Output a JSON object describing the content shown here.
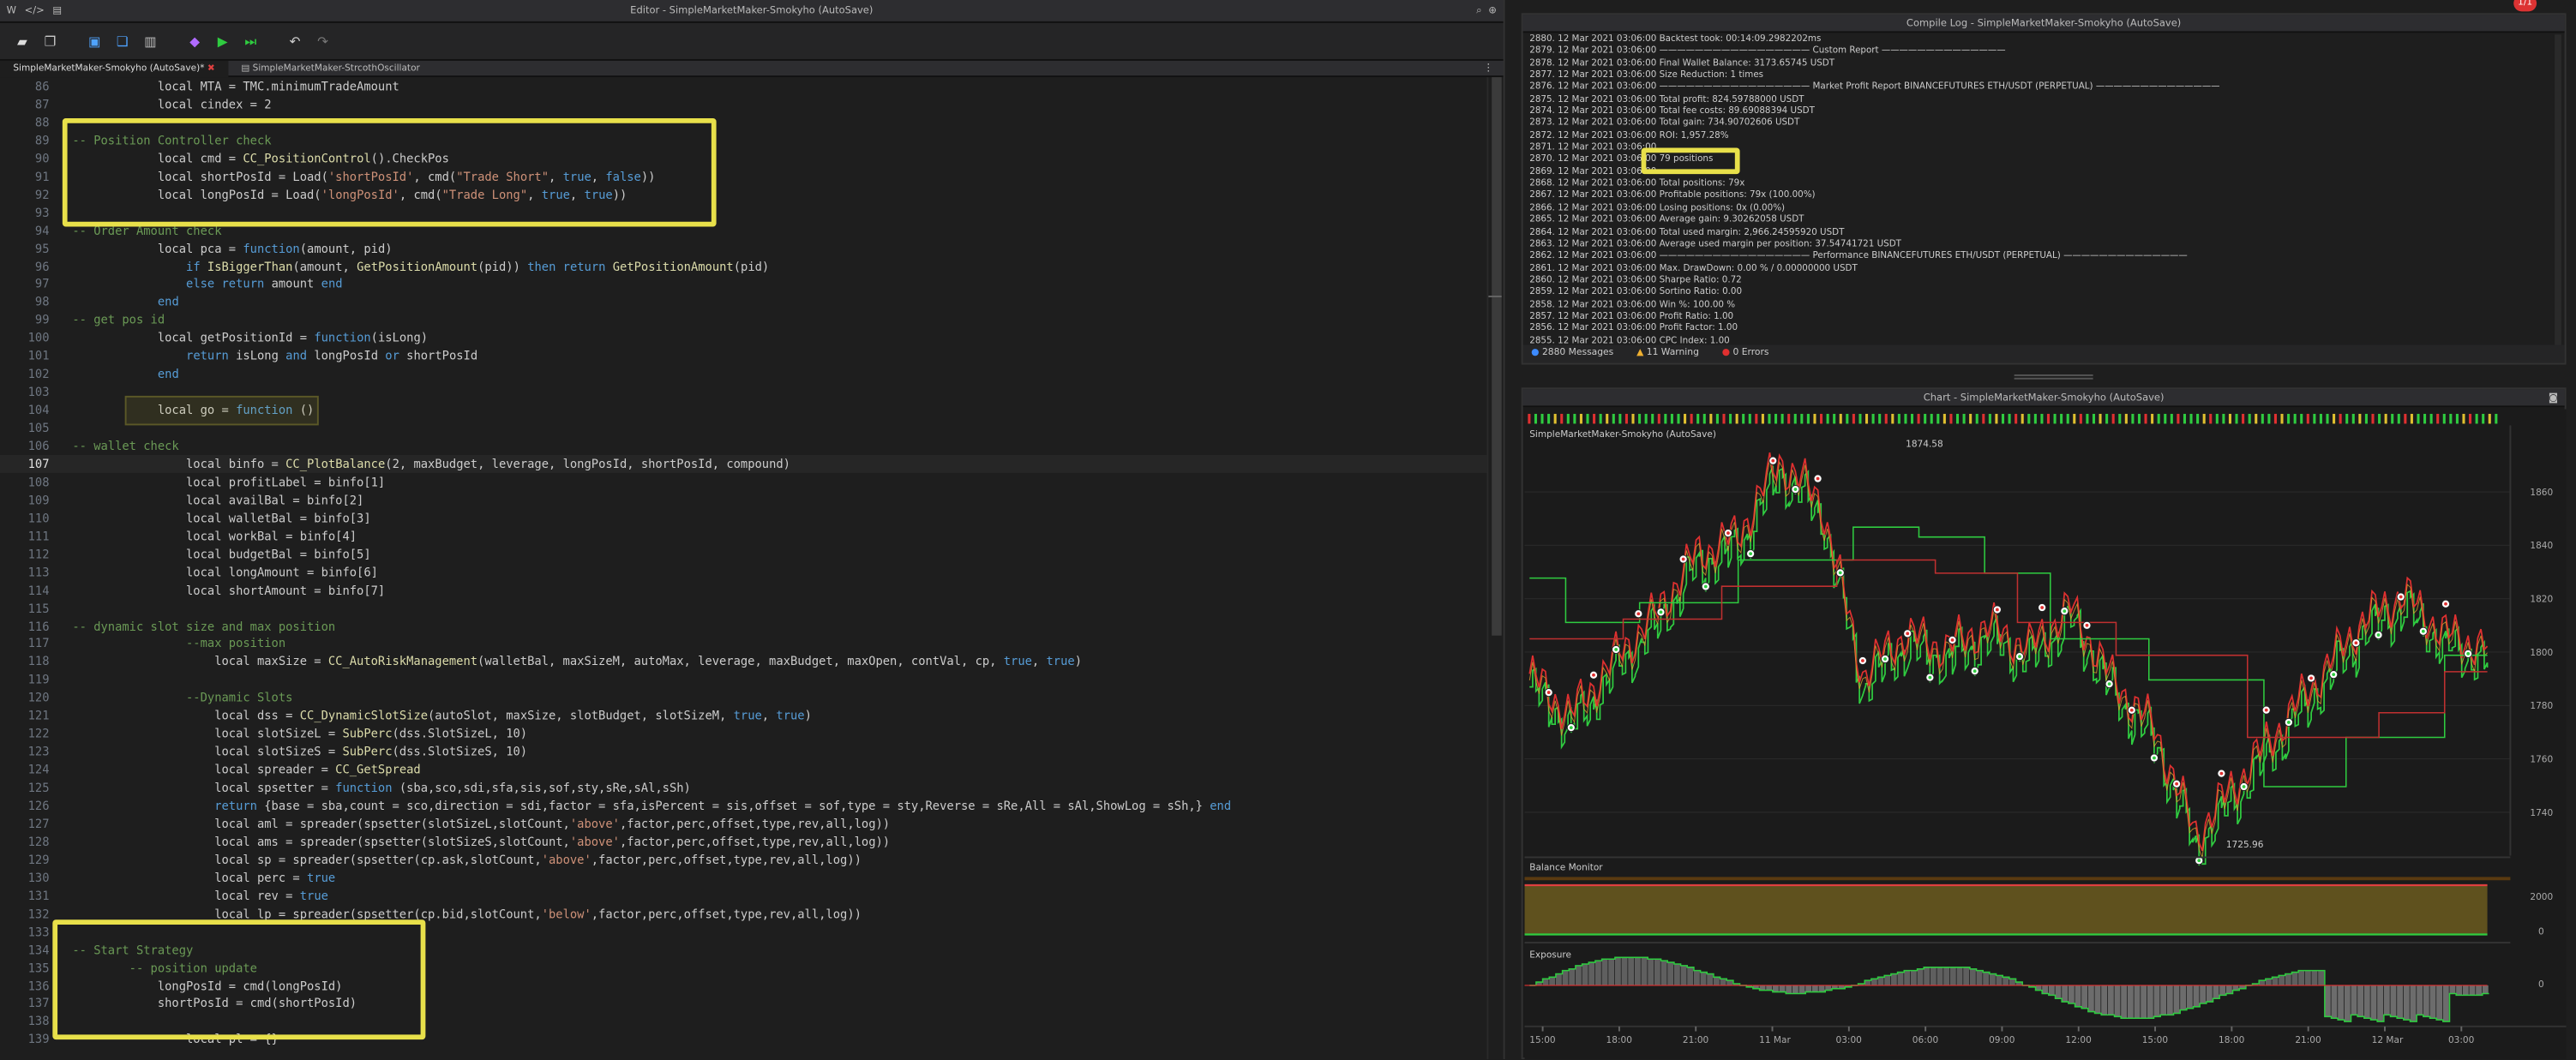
{
  "editor": {
    "title": "Editor - SimpleMarketMaker-Smokyho (AutoSave)",
    "tabs": [
      "SimpleMarketMaker-Smokyho (AutoSave)*",
      "SimpleMarketMaker-StrcothOscillator"
    ],
    "lines": [
      {
        "n": "86",
        "t": [
          [
            "            local MTA = TMC.minimumTradeAmount",
            ""
          ]
        ]
      },
      {
        "n": "87",
        "t": [
          [
            "            local cindex = 2",
            ""
          ]
        ]
      },
      {
        "n": "88",
        "t": [
          [
            "",
            ""
          ]
        ]
      },
      {
        "n": "89",
        "t": [
          [
            "-- Position Controller check",
            "c"
          ]
        ]
      },
      {
        "n": "90",
        "t": [
          [
            "            local cmd = ",
            ""
          ],
          [
            "CC_PositionControl",
            "f"
          ],
          [
            "().CheckPos",
            ""
          ]
        ]
      },
      {
        "n": "91",
        "t": [
          [
            "            local shortPosId = Load(",
            ""
          ],
          [
            "'shortPosId'",
            "s"
          ],
          [
            ", cmd(",
            ""
          ],
          [
            "\"Trade Short\"",
            "s"
          ],
          [
            ", ",
            ""
          ],
          [
            "true",
            "b"
          ],
          [
            ", ",
            ""
          ],
          [
            "false",
            "b"
          ],
          [
            "))",
            ""
          ]
        ]
      },
      {
        "n": "92",
        "t": [
          [
            "            local longPosId = Load(",
            ""
          ],
          [
            "'longPosId'",
            "s"
          ],
          [
            ", cmd(",
            ""
          ],
          [
            "\"Trade Long\"",
            "s"
          ],
          [
            ", ",
            ""
          ],
          [
            "true",
            "b"
          ],
          [
            ", ",
            ""
          ],
          [
            "true",
            "b"
          ],
          [
            "))",
            ""
          ]
        ]
      },
      {
        "n": "93",
        "t": [
          [
            "",
            ""
          ]
        ]
      },
      {
        "n": "94",
        "t": [
          [
            "-- Order Amount check",
            "c"
          ]
        ]
      },
      {
        "n": "95",
        "t": [
          [
            "            local pca = ",
            ""
          ],
          [
            "function",
            "k"
          ],
          [
            "(amount, pid)",
            ""
          ]
        ]
      },
      {
        "n": "96",
        "t": [
          [
            "                ",
            ""
          ],
          [
            "if",
            "k"
          ],
          [
            " ",
            ""
          ],
          [
            "IsBiggerThan",
            "f"
          ],
          [
            "(amount, ",
            ""
          ],
          [
            "GetPositionAmount",
            "f"
          ],
          [
            "(pid)) ",
            ""
          ],
          [
            "then",
            "k"
          ],
          [
            " ",
            ""
          ],
          [
            "return",
            "k"
          ],
          [
            " ",
            ""
          ],
          [
            "GetPositionAmount",
            "f"
          ],
          [
            "(pid)",
            ""
          ]
        ]
      },
      {
        "n": "97",
        "t": [
          [
            "                ",
            ""
          ],
          [
            "else",
            "k"
          ],
          [
            " ",
            ""
          ],
          [
            "return",
            "k"
          ],
          [
            " amount ",
            ""
          ],
          [
            "end",
            "k"
          ]
        ]
      },
      {
        "n": "98",
        "t": [
          [
            "            ",
            ""
          ],
          [
            "end",
            "k"
          ]
        ]
      },
      {
        "n": "99",
        "t": [
          [
            "-- get pos id",
            "c"
          ]
        ]
      },
      {
        "n": "100",
        "t": [
          [
            "            local getPositionId = ",
            ""
          ],
          [
            "function",
            "k"
          ],
          [
            "(isLong)",
            ""
          ]
        ]
      },
      {
        "n": "101",
        "t": [
          [
            "                ",
            ""
          ],
          [
            "return",
            "k"
          ],
          [
            " isLong ",
            ""
          ],
          [
            "and",
            "k"
          ],
          [
            " longPosId ",
            ""
          ],
          [
            "or",
            "k"
          ],
          [
            " shortPosId",
            ""
          ]
        ]
      },
      {
        "n": "102",
        "t": [
          [
            "            ",
            ""
          ],
          [
            "end",
            "k"
          ]
        ]
      },
      {
        "n": "103",
        "t": [
          [
            "",
            ""
          ]
        ]
      },
      {
        "n": "104",
        "t": [
          [
            "            local go = ",
            ""
          ],
          [
            "function",
            "k"
          ],
          [
            " ()",
            ""
          ]
        ]
      },
      {
        "n": "105",
        "t": [
          [
            "",
            ""
          ]
        ]
      },
      {
        "n": "106",
        "t": [
          [
            "-- wallet check",
            "c"
          ]
        ]
      },
      {
        "n": "107",
        "t": [
          [
            "                local binfo = ",
            ""
          ],
          [
            "CC_PlotBalance",
            "f"
          ],
          [
            "(2, maxBudget, leverage, longPosId, shortPosId, compound)",
            ""
          ]
        ]
      },
      {
        "n": "108",
        "t": [
          [
            "                local profitLabel = binfo[1]",
            ""
          ]
        ]
      },
      {
        "n": "109",
        "t": [
          [
            "                local availBal = binfo[2]",
            ""
          ]
        ]
      },
      {
        "n": "110",
        "t": [
          [
            "                local walletBal = binfo[3]",
            ""
          ]
        ]
      },
      {
        "n": "111",
        "t": [
          [
            "                local workBal = binfo[4]",
            ""
          ]
        ]
      },
      {
        "n": "112",
        "t": [
          [
            "                local budgetBal = binfo[5]",
            ""
          ]
        ]
      },
      {
        "n": "113",
        "t": [
          [
            "                local longAmount = binfo[6]",
            ""
          ]
        ]
      },
      {
        "n": "114",
        "t": [
          [
            "                local shortAmount = binfo[7]",
            ""
          ]
        ]
      },
      {
        "n": "115",
        "t": [
          [
            "",
            ""
          ]
        ]
      },
      {
        "n": "116",
        "t": [
          [
            "-- dynamic slot size and max position",
            "c"
          ]
        ]
      },
      {
        "n": "117",
        "t": [
          [
            "                --max position",
            "c"
          ]
        ]
      },
      {
        "n": "118",
        "t": [
          [
            "                    local maxSize = ",
            ""
          ],
          [
            "CC_AutoRiskManagement",
            "f"
          ],
          [
            "(walletBal, maxSizeM, autoMax, leverage, maxBudget, maxOpen, contVal, cp, ",
            ""
          ],
          [
            "true",
            "b"
          ],
          [
            ", ",
            ""
          ],
          [
            "true",
            "b"
          ],
          [
            ")",
            ""
          ]
        ]
      },
      {
        "n": "119",
        "t": [
          [
            "",
            ""
          ]
        ]
      },
      {
        "n": "120",
        "t": [
          [
            "                --Dynamic Slots",
            "c"
          ]
        ]
      },
      {
        "n": "121",
        "t": [
          [
            "                    local dss = ",
            ""
          ],
          [
            "CC_DynamicSlotSize",
            "f"
          ],
          [
            "(autoSlot, maxSize, slotBudget, slotSizeM, ",
            ""
          ],
          [
            "true",
            "b"
          ],
          [
            ", ",
            ""
          ],
          [
            "true",
            "b"
          ],
          [
            ")",
            ""
          ]
        ]
      },
      {
        "n": "122",
        "t": [
          [
            "                    local slotSizeL = ",
            ""
          ],
          [
            "SubPerc",
            "f"
          ],
          [
            "(dss.SlotSizeL, 10)",
            ""
          ]
        ]
      },
      {
        "n": "123",
        "t": [
          [
            "                    local slotSizeS = ",
            ""
          ],
          [
            "SubPerc",
            "f"
          ],
          [
            "(dss.SlotSizeS, 10)",
            ""
          ]
        ]
      },
      {
        "n": "124",
        "t": [
          [
            "                    local spreader = ",
            ""
          ],
          [
            "CC_GetSpread",
            "f"
          ]
        ]
      },
      {
        "n": "125",
        "t": [
          [
            "                    local spsetter = ",
            ""
          ],
          [
            "function",
            "k"
          ],
          [
            " (sba,sco,sdi,sfa,sis,sof,sty,sRe,sAl,sSh)",
            ""
          ]
        ]
      },
      {
        "n": "126",
        "t": [
          [
            "                    ",
            ""
          ],
          [
            "return",
            "k"
          ],
          [
            " {base = sba,count = sco,direction = sdi,factor = sfa,isPercent = sis,offset = sof,type = sty,Reverse = sRe,All = sAl,ShowLog = sSh,} ",
            ""
          ],
          [
            "end",
            "k"
          ]
        ]
      },
      {
        "n": "127",
        "t": [
          [
            "                    local aml = spreader(spsetter(slotSizeL,slotCount,",
            ""
          ],
          [
            "'above'",
            "s"
          ],
          [
            ",factor,perc,offset,type,rev,all,log))",
            ""
          ]
        ]
      },
      {
        "n": "128",
        "t": [
          [
            "                    local ams = spreader(spsetter(slotSizeS,slotCount,",
            ""
          ],
          [
            "'above'",
            "s"
          ],
          [
            ",factor,perc,offset,type,rev,all,log))",
            ""
          ]
        ]
      },
      {
        "n": "129",
        "t": [
          [
            "                    local sp = spreader(spsetter(cp.ask,slotCount,",
            ""
          ],
          [
            "'above'",
            "s"
          ],
          [
            ",factor,perc,offset,type,rev,all,log))",
            ""
          ]
        ]
      },
      {
        "n": "130",
        "t": [
          [
            "                    local perc = ",
            ""
          ],
          [
            "true",
            "b"
          ]
        ]
      },
      {
        "n": "131",
        "t": [
          [
            "                    local rev = ",
            ""
          ],
          [
            "true",
            "b"
          ]
        ]
      },
      {
        "n": "132",
        "t": [
          [
            "                    local lp = spreader(spsetter(cp.bid,slotCount,",
            ""
          ],
          [
            "'below'",
            "s"
          ],
          [
            ",factor,perc,offset,type,rev,all,log))",
            ""
          ]
        ]
      },
      {
        "n": "133",
        "t": [
          [
            "",
            ""
          ]
        ]
      },
      {
        "n": "134",
        "t": [
          [
            "-- Start Strategy",
            "c"
          ]
        ]
      },
      {
        "n": "135",
        "t": [
          [
            "        -- position update",
            "c"
          ]
        ]
      },
      {
        "n": "136",
        "t": [
          [
            "            longPosId = cmd(longPosId)",
            ""
          ]
        ]
      },
      {
        "n": "137",
        "t": [
          [
            "            shortPosId = cmd(shortPosId)",
            ""
          ]
        ]
      },
      {
        "n": "138",
        "t": [
          [
            "",
            ""
          ]
        ]
      },
      {
        "n": "139",
        "t": [
          [
            "                local pl = {}",
            ""
          ]
        ]
      }
    ]
  },
  "log": {
    "title": "Compile Log - SimpleMarketMaker-Smokyho (AutoSave)",
    "lines": [
      "2880. 12 Mar 2021 03:06:00 Backtest took: 00:14:09.2982202ms",
      "2879. 12 Mar 2021 03:06:00 ————————————————— Custom Report ——————————————",
      "2878. 12 Mar 2021 03:06:00 Final Wallet Balance: 3173.65745 USDT",
      "2877. 12 Mar 2021 03:06:00 Size Reduction: 1 times",
      "2876. 12 Mar 2021 03:06:00 ————————————————— Market Profit Report BINANCEFUTURES ETH/USDT (PERPETUAL) ——————————————",
      "2875. 12 Mar 2021 03:06:00 Total profit: 824.59788000 USDT",
      "2874. 12 Mar 2021 03:06:00 Total fee costs: 89.69088394 USDT",
      "2873. 12 Mar 2021 03:06:00 Total gain: 734.90702606 USDT",
      "2872. 12 Mar 2021 03:06:00 ROI: 1,957.28%",
      "2871. 12 Mar 2021 03:06:00",
      "2870. 12 Mar 2021 03:06:00 79 positions",
      "2869. 12 Mar 2021 03:06:00",
      "2868. 12 Mar 2021 03:06:00 Total positions: 79x",
      "2867. 12 Mar 2021 03:06:00 Profitable positions: 79x (100.00%)",
      "2866. 12 Mar 2021 03:06:00 Losing positions: 0x (0.00%)",
      "2865. 12 Mar 2021 03:06:00 Average gain: 9.30262058 USDT",
      "2864. 12 Mar 2021 03:06:00 Total used margin: 2,966.24595920 USDT",
      "2863. 12 Mar 2021 03:06:00 Average used margin per position: 37.54741721 USDT",
      "2862. 12 Mar 2021 03:06:00 ————————————————— Performance BINANCEFUTURES ETH/USDT (PERPETUAL) ——————————————",
      "2861. 12 Mar 2021 03:06:00 Max. DrawDown: 0.00 % / 0.00000000 USDT",
      "2860. 12 Mar 2021 03:06:00 Sharpe Ratio: 0.72",
      "2859. 12 Mar 2021 03:06:00 Sortino Ratio: 0.00",
      "2858. 12 Mar 2021 03:06:00 Win %: 100.00 %",
      "2857. 12 Mar 2021 03:06:00 Profit Ratio: 1.00",
      "2856. 12 Mar 2021 03:06:00 Profit Factor: 1.00",
      "2855. 12 Mar 2021 03:06:00 CPC Index: 1.00"
    ],
    "messages": "2880 Messages",
    "warnings": "11 Warning",
    "errors": "0 Errors"
  },
  "chart": {
    "title": "Chart - SimpleMarketMaker-Smokyho (AutoSave)",
    "label": "SimpleMarketMaker-Smokyho (AutoSave)",
    "high_label": "1874.58",
    "low_label": "1725.96",
    "balance_label": "Balance Monitor",
    "exposure_label": "Exposure",
    "badge": "1/1"
  },
  "chart_data": [
    {
      "type": "line",
      "title": "SimpleMarketMaker-Smokyho (AutoSave)",
      "x": [
        "15:00",
        "18:00",
        "21:00",
        "11 Mar",
        "03:00",
        "06:00",
        "09:00",
        "12:00",
        "15:00",
        "18:00",
        "21:00",
        "12 Mar",
        "03:00"
      ],
      "series": [
        {
          "values": [
            1790,
            1775,
            1795,
            1812,
            1835,
            1842,
            1870,
            1855,
            1790,
            1805,
            1800,
            1808,
            1800,
            1815,
            1788,
            1770,
            1730,
            1750,
            1770,
            1790,
            1810,
            1820,
            1805,
            1800
          ]
        }
      ],
      "ylim": [
        1725,
        1880
      ],
      "yticks": [
        1740,
        1760,
        1780,
        1800,
        1820,
        1840,
        1860
      ],
      "annotations": [
        "1874.58",
        "1725.96"
      ]
    },
    {
      "type": "area",
      "title": "Balance Monitor",
      "yticks": [
        0,
        2000
      ]
    },
    {
      "type": "area",
      "title": "Exposure",
      "yticks": [
        0
      ]
    }
  ]
}
